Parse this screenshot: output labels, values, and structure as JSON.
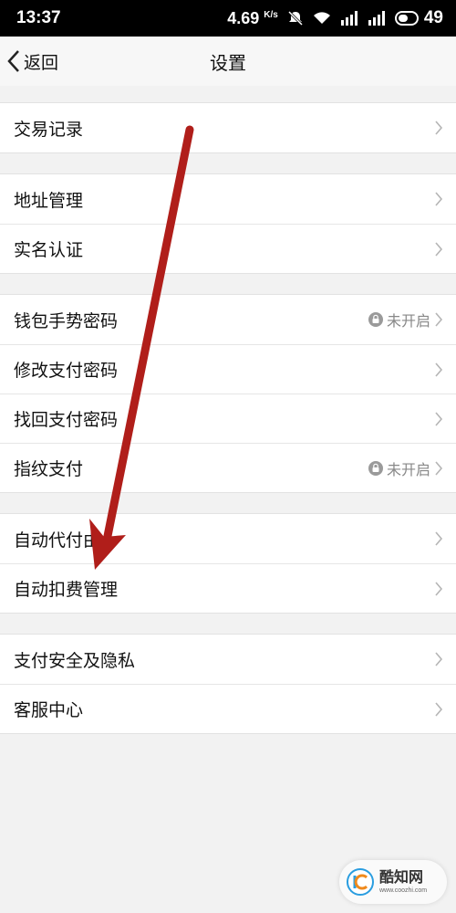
{
  "status_bar": {
    "time": "13:37",
    "speed": "4.69",
    "speed_unit": "K/s",
    "battery": "49"
  },
  "navbar": {
    "back_label": "返回",
    "title": "设置"
  },
  "groups": [
    {
      "items": [
        {
          "label": "交易记录",
          "status": ""
        }
      ]
    },
    {
      "items": [
        {
          "label": "地址管理",
          "status": ""
        },
        {
          "label": "实名认证",
          "status": ""
        }
      ]
    },
    {
      "items": [
        {
          "label": "钱包手势密码",
          "status": "未开启"
        },
        {
          "label": "修改支付密码",
          "status": ""
        },
        {
          "label": "找回支付密码",
          "status": ""
        },
        {
          "label": "指纹支付",
          "status": "未开启"
        }
      ]
    },
    {
      "items": [
        {
          "label": "自动代付由",
          "status": ""
        },
        {
          "label": "自动扣费管理",
          "status": ""
        }
      ]
    },
    {
      "items": [
        {
          "label": "支付安全及隐私",
          "status": ""
        },
        {
          "label": "客服中心",
          "status": ""
        }
      ]
    }
  ],
  "watermark": {
    "name": "酷知网",
    "url": "www.coozhi.com"
  },
  "colors": {
    "arrow": "#b01e1a",
    "background": "#f2f2f2"
  }
}
